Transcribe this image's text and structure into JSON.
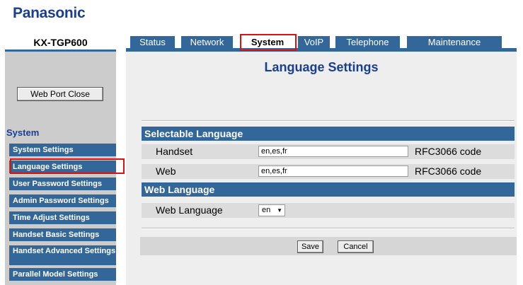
{
  "brand": "Panasonic",
  "model": "KX-TGP600",
  "tabs": [
    {
      "label": "Status",
      "active": false
    },
    {
      "label": "Network",
      "active": false
    },
    {
      "label": "System",
      "active": true
    },
    {
      "label": "VoIP",
      "active": false
    },
    {
      "label": "Telephone",
      "active": false
    },
    {
      "label": "Maintenance",
      "active": false
    }
  ],
  "sidebar": {
    "web_port_close": "Web Port Close",
    "section_title": "System",
    "items": [
      {
        "label": "System Settings",
        "selected": false
      },
      {
        "label": "Language Settings",
        "selected": true
      },
      {
        "label": "User Password Settings",
        "selected": false
      },
      {
        "label": "Admin Password Settings",
        "selected": false
      },
      {
        "label": "Time Adjust Settings",
        "selected": false
      },
      {
        "label": "Handset Basic Settings",
        "selected": false
      },
      {
        "label": "Handset Advanced Settings",
        "selected": false
      },
      {
        "label": "Parallel Model Settings",
        "selected": false
      }
    ]
  },
  "main": {
    "title": "Language Settings",
    "selectable_language": {
      "heading": "Selectable Language",
      "handset": {
        "label": "Handset",
        "value": "en,es,fr",
        "note": "RFC3066 code"
      },
      "web": {
        "label": "Web",
        "value": "en,es,fr",
        "note": "RFC3066 code"
      }
    },
    "web_language": {
      "heading": "Web Language",
      "label": "Web Language",
      "selected": "en"
    },
    "buttons": {
      "save": "Save",
      "cancel": "Cancel"
    }
  },
  "colors": {
    "brand_blue": "#1a3e91",
    "tab_blue": "#336699",
    "highlight_red": "#e01010",
    "panel_grey": "#cccccc"
  }
}
